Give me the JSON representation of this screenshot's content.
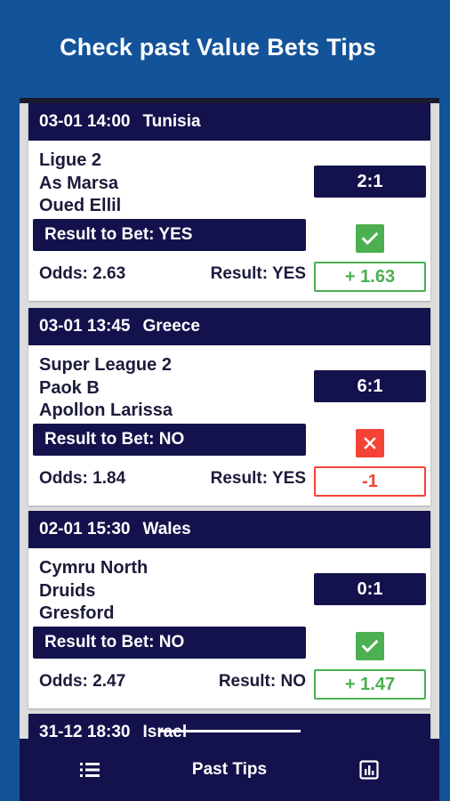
{
  "promo": {
    "title": "Check past Value Bets Tips"
  },
  "tips": [
    {
      "date": "03-01 14:00",
      "country": "Tunisia",
      "league": "Ligue 2",
      "home": "As Marsa",
      "away": "Oued Ellil",
      "score": "2:1",
      "result_to_bet": "Result to Bet: YES",
      "odds": "Odds: 2.63",
      "result": "Result: YES",
      "profit": "+ 1.63",
      "status": "win"
    },
    {
      "date": "03-01 13:45",
      "country": "Greece",
      "league": "Super League 2",
      "home": "Paok B",
      "away": "Apollon Larissa",
      "score": "6:1",
      "result_to_bet": "Result to Bet: NO",
      "odds": "Odds: 1.84",
      "result": "Result: YES",
      "profit": "-1",
      "status": "lose"
    },
    {
      "date": "02-01 15:30",
      "country": "Wales",
      "league": "Cymru North",
      "home": "Druids",
      "away": "Gresford",
      "score": "0:1",
      "result_to_bet": "Result to Bet: NO",
      "odds": "Odds: 2.47",
      "result": "Result: NO",
      "profit": "+ 1.47",
      "status": "win"
    },
    {
      "date": "31-12 18:30",
      "country": "Israel"
    }
  ],
  "bottom_nav": {
    "label": "Past Tips",
    "left_icon": "list-icon",
    "right_icon": "chart-icon"
  },
  "colors": {
    "navy": "#14124c",
    "background": "#13539a",
    "win": "#4caf50",
    "lose": "#f44336"
  }
}
